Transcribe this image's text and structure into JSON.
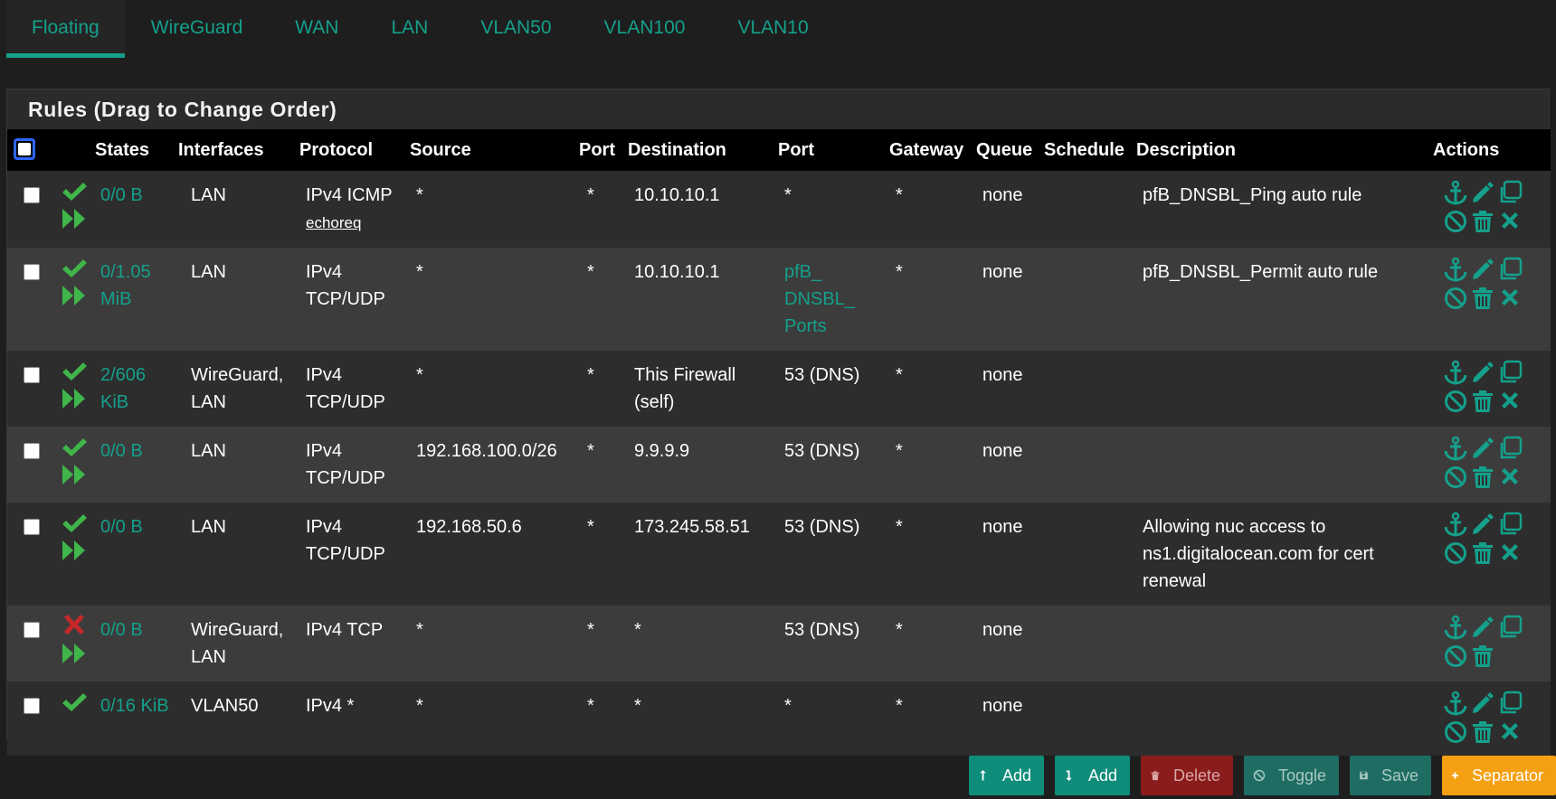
{
  "tabs": [
    {
      "label": "Floating",
      "active": true
    },
    {
      "label": "WireGuard"
    },
    {
      "label": "WAN"
    },
    {
      "label": "LAN"
    },
    {
      "label": "VLAN50"
    },
    {
      "label": "VLAN100"
    },
    {
      "label": "VLAN10"
    }
  ],
  "panel": {
    "title": "Rules (Drag to Change Order)"
  },
  "columns": {
    "states": "States",
    "interfaces": "Interfaces",
    "protocol": "Protocol",
    "source": "Source",
    "port": "Port",
    "destination": "Destination",
    "dport": "Port",
    "gateway": "Gateway",
    "queue": "Queue",
    "schedule": "Schedule",
    "description": "Description",
    "actions": "Actions"
  },
  "rows": [
    {
      "status": "pass",
      "states": "0/0 B",
      "interfaces": "LAN",
      "protocol": "IPv4 ICMP",
      "protocol_sub": "echoreq",
      "source": "*",
      "sport": "*",
      "destination": "10.10.10.1",
      "dport": "*",
      "gateway": "*",
      "queue": "none",
      "schedule": "",
      "description": "pfB_DNSBL_Ping auto rule",
      "has_delete_x": true
    },
    {
      "status": "pass",
      "states": "0/1.05 MiB",
      "interfaces": "LAN",
      "protocol": "IPv4 TCP/UDP",
      "protocol_sub": "",
      "source": "*",
      "sport": "*",
      "destination": "10.10.10.1",
      "dport": "pfB_ DNSBL_ Ports",
      "dport_alias": true,
      "gateway": "*",
      "queue": "none",
      "schedule": "",
      "description": "pfB_DNSBL_Permit auto rule",
      "has_delete_x": true
    },
    {
      "status": "pass",
      "states": "2/606 KiB",
      "interfaces": "WireGuard, LAN",
      "protocol": "IPv4 TCP/UDP",
      "protocol_sub": "",
      "source": "*",
      "sport": "*",
      "destination": "This Firewall (self)",
      "dport": "53 (DNS)",
      "gateway": "*",
      "queue": "none",
      "schedule": "",
      "description": "",
      "has_delete_x": true
    },
    {
      "status": "pass",
      "states": "0/0 B",
      "interfaces": "LAN",
      "protocol": "IPv4 TCP/UDP",
      "protocol_sub": "",
      "source": "192.168.100.0/26",
      "sport": "*",
      "destination": "9.9.9.9",
      "dport": "53 (DNS)",
      "gateway": "*",
      "queue": "none",
      "schedule": "",
      "description": "",
      "has_delete_x": true
    },
    {
      "status": "pass",
      "states": "0/0 B",
      "interfaces": "LAN",
      "protocol": "IPv4 TCP/UDP",
      "protocol_sub": "",
      "source": "192.168.50.6",
      "sport": "*",
      "destination": "173.245.58.51",
      "dport": "53 (DNS)",
      "gateway": "*",
      "queue": "none",
      "schedule": "",
      "description": "Allowing nuc access to ns1.digitalocean.com for cert renewal",
      "has_delete_x": true
    },
    {
      "status": "block",
      "states": "0/0 B",
      "interfaces": "WireGuard, LAN",
      "protocol": "IPv4 TCP",
      "protocol_sub": "",
      "source": "*",
      "sport": "*",
      "destination": "*",
      "dport": "53 (DNS)",
      "gateway": "*",
      "queue": "none",
      "schedule": "",
      "description": "",
      "has_delete_x": false
    },
    {
      "status": "pass",
      "states": "0/16 KiB",
      "interfaces": "VLAN50",
      "protocol": "IPv4 *",
      "protocol_sub": "",
      "source": "*",
      "sport": "*",
      "destination": "*",
      "dport": "*",
      "gateway": "*",
      "queue": "none",
      "schedule": "",
      "description": "",
      "has_delete_x": true,
      "no_forward_icon": true
    }
  ],
  "buttons": {
    "add_top": "Add",
    "add_bottom": "Add",
    "delete": "Delete",
    "toggle": "Toggle",
    "save": "Save",
    "separator": "Separator"
  },
  "icons": {
    "pass": "check-icon",
    "block": "x-icon",
    "forward": "fast-forward-icon",
    "anchor": "anchor-icon",
    "edit": "pencil-icon",
    "copy": "copy-icon",
    "disable": "ban-icon",
    "delete": "trash-icon",
    "close": "times-icon"
  },
  "colors": {
    "accent": "#14a08b",
    "pass": "#3fb54a",
    "block": "#c62828",
    "separator": "#f5a012",
    "delete": "#8a1c1c"
  }
}
